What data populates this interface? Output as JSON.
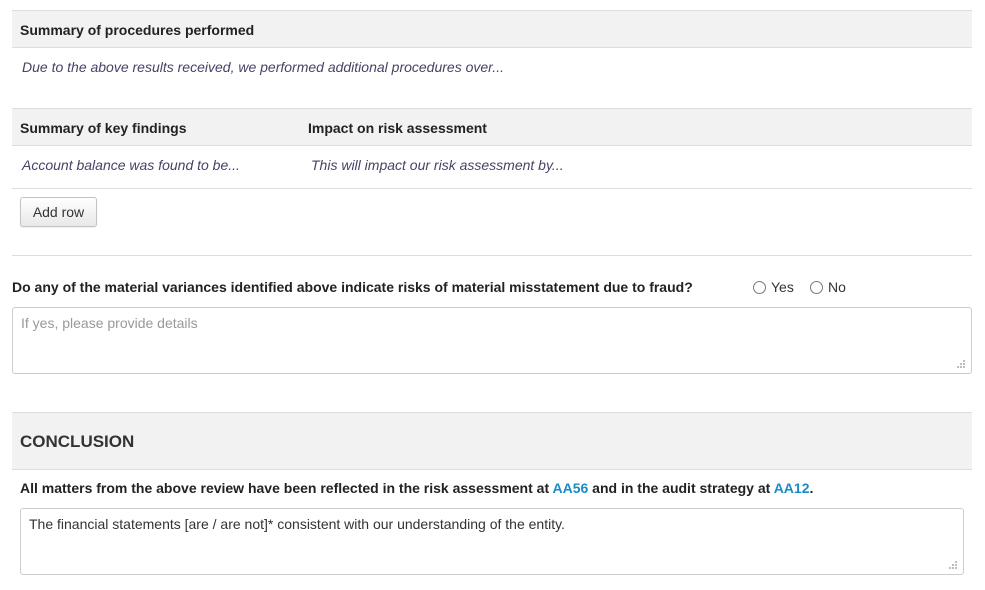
{
  "procedures": {
    "header": "Summary of procedures performed",
    "text": "Due to the above results received, we performed additional procedures over..."
  },
  "findings": {
    "col_findings": "Summary of key findings",
    "col_impact": "Impact on risk assessment",
    "rows": [
      {
        "finding": "Account balance was found to be...",
        "impact": "This will impact our risk assessment by..."
      }
    ],
    "add_row_label": "Add row"
  },
  "fraud": {
    "question": "Do any of the material variances identified above indicate risks of material misstatement due to fraud?",
    "options": [
      "Yes",
      "No"
    ],
    "details_placeholder": "If yes, please provide details"
  },
  "conclusion": {
    "title": "CONCLUSION",
    "statement_prefix": "All matters from the above review have been reflected in the risk assessment at",
    "link_risk": "AA56",
    "statement_middle": "and in the audit strategy at",
    "link_strategy": "AA12",
    "statement_suffix": ".",
    "textarea_value": "The financial statements [are / are not]* consistent with our understanding of the entity."
  },
  "colors": {
    "header_bg": "#f2f2f2",
    "link": "#1a8bc4",
    "border": "#dddddd"
  }
}
